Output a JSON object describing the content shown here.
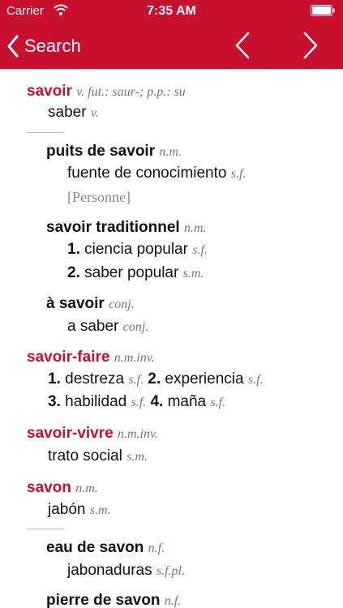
{
  "status_bar": {
    "carrier": "Carrier",
    "time": "7:35 AM"
  },
  "nav": {
    "back_label": "Search"
  },
  "entries": {
    "savoir": {
      "headword": "savoir",
      "gram": "v. fut.: saur-; p.p.: su",
      "translation": "saber",
      "translation_gram": "v."
    },
    "puits": {
      "headword": "puits de savoir",
      "gram": "n.m.",
      "translation": "fuente de conocimiento",
      "translation_gram": "s.f.",
      "note": "[Personne]"
    },
    "savoir_traditionnel": {
      "headword": "savoir traditionnel",
      "gram": "n.m.",
      "senses": [
        {
          "num": "1.",
          "text": "ciencia popular",
          "gram": "s.f."
        },
        {
          "num": "2.",
          "text": "saber popular",
          "gram": "s.m."
        }
      ]
    },
    "a_savoir": {
      "headword": "à savoir",
      "gram": "conj.",
      "translation": "a saber",
      "translation_gram": "conj."
    },
    "savoir_faire": {
      "headword": "savoir-faire",
      "gram": "n.m.inv.",
      "senses": [
        {
          "num": "1.",
          "text": "destreza",
          "gram": "s.f."
        },
        {
          "num": "2.",
          "text": "experiencia",
          "gram": "s.f."
        },
        {
          "num": "3.",
          "text": "habilidad",
          "gram": "s.f."
        },
        {
          "num": "4.",
          "text": "maña",
          "gram": "s.f."
        }
      ]
    },
    "savoir_vivre": {
      "headword": "savoir-vivre",
      "gram": "n.m.inv.",
      "translation": "trato social",
      "translation_gram": "s.m."
    },
    "savon": {
      "headword": "savon",
      "gram": "n.m.",
      "translation": "jabón",
      "translation_gram": "s.m."
    },
    "eau_de_savon": {
      "headword": "eau de savon",
      "gram": "n.f.",
      "translation": "jabonaduras",
      "translation_gram": "s.f.pl."
    },
    "pierre_de_savon": {
      "headword": "pierre de savon",
      "gram": "n.f."
    }
  },
  "icons": {
    "back": "chevron-left-icon",
    "prev": "chevron-left-icon",
    "next": "chevron-right-icon",
    "wifi": "wifi-icon",
    "battery": "battery-icon"
  },
  "colors": {
    "accent": "#c8102e",
    "text": "#111111",
    "gram": "#777777"
  }
}
